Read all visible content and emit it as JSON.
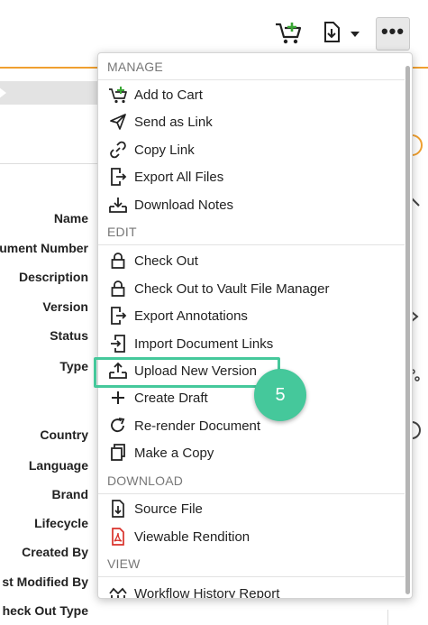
{
  "toolbar": {
    "cart_icon": "cart-plus-icon",
    "download_icon": "file-download-icon",
    "dropdown_icon": "caret-down-icon",
    "more_label": "•••"
  },
  "fields": [
    {
      "label": "Name"
    },
    {
      "label": "ument Number"
    },
    {
      "label": "Description"
    },
    {
      "label": "Version"
    },
    {
      "label": "Status"
    },
    {
      "label": "Type"
    },
    {
      "label": "Country"
    },
    {
      "label": "Language"
    },
    {
      "label": "Brand"
    },
    {
      "label": "Lifecycle"
    },
    {
      "label": "Created By"
    },
    {
      "label": "st Modified By"
    },
    {
      "label": "heck Out Type"
    }
  ],
  "menu": {
    "sections": {
      "manage": "MANAGE",
      "edit": "EDIT",
      "download": "DOWNLOAD",
      "view": "VIEW"
    },
    "items": [
      {
        "label": "Add to Cart",
        "icon": "cart-plus-icon"
      },
      {
        "label": "Send as Link",
        "icon": "paper-plane-icon"
      },
      {
        "label": "Copy Link",
        "icon": "link-icon"
      },
      {
        "label": "Export All Files",
        "icon": "file-export-icon"
      },
      {
        "label": "Download Notes",
        "icon": "tray-download-icon"
      },
      {
        "label": "Check Out",
        "icon": "lock-icon"
      },
      {
        "label": "Check Out to Vault File Manager",
        "icon": "lock-icon"
      },
      {
        "label": "Export Annotations",
        "icon": "file-export-icon"
      },
      {
        "label": "Import Document Links",
        "icon": "file-import-icon"
      },
      {
        "label": "Upload New Version",
        "icon": "tray-upload-icon"
      },
      {
        "label": "Create Draft",
        "icon": "plus-icon"
      },
      {
        "label": "Re-render Document",
        "icon": "rotate-icon"
      },
      {
        "label": "Make a Copy",
        "icon": "copy-icon"
      },
      {
        "label": "Source File",
        "icon": "file-download-icon"
      },
      {
        "label": "Viewable Rendition",
        "icon": "pdf-icon"
      },
      {
        "label": "Workflow History Report",
        "icon": "workflow-icon"
      }
    ]
  },
  "callout": {
    "step": "5"
  },
  "colors": {
    "accent": "#45c89b",
    "orange": "#f0a030",
    "cart_green": "#3aa635",
    "pdf_red": "#d9322b"
  }
}
